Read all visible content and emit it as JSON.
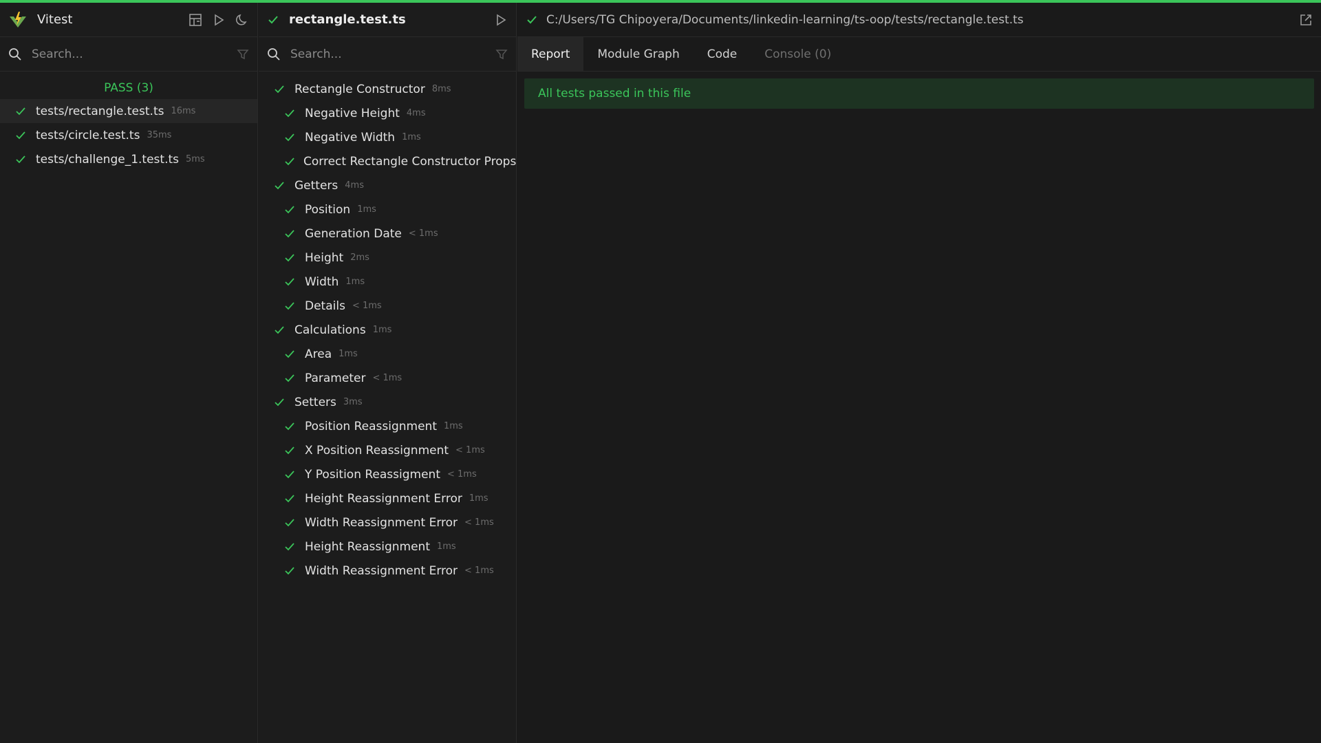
{
  "app": {
    "name": "Vitest"
  },
  "file_explorer": {
    "search_placeholder": "Search...",
    "pass_label": "PASS (3)",
    "files": [
      {
        "name": "tests/rectangle.test.ts",
        "duration": "16ms"
      },
      {
        "name": "tests/circle.test.ts",
        "duration": "35ms"
      },
      {
        "name": "tests/challenge_1.test.ts",
        "duration": "5ms"
      }
    ]
  },
  "test_panel": {
    "file_title": "rectangle.test.ts",
    "search_placeholder": "Search...",
    "tests": [
      {
        "name": "Rectangle Constructor",
        "duration": "8ms",
        "level": 0
      },
      {
        "name": "Negative Height",
        "duration": "4ms",
        "level": 1
      },
      {
        "name": "Negative Width",
        "duration": "1ms",
        "level": 1
      },
      {
        "name": "Correct Rectangle Constructor Props",
        "duration": "",
        "level": 1
      },
      {
        "name": "Getters",
        "duration": "4ms",
        "level": 0
      },
      {
        "name": "Position",
        "duration": "1ms",
        "level": 1
      },
      {
        "name": "Generation Date",
        "duration": "< 1ms",
        "level": 1
      },
      {
        "name": "Height",
        "duration": "2ms",
        "level": 1
      },
      {
        "name": "Width",
        "duration": "1ms",
        "level": 1
      },
      {
        "name": "Details",
        "duration": "< 1ms",
        "level": 1
      },
      {
        "name": "Calculations",
        "duration": "1ms",
        "level": 0
      },
      {
        "name": "Area",
        "duration": "1ms",
        "level": 1
      },
      {
        "name": "Parameter",
        "duration": "< 1ms",
        "level": 1
      },
      {
        "name": "Setters",
        "duration": "3ms",
        "level": 0
      },
      {
        "name": "Position Reassignment",
        "duration": "1ms",
        "level": 1
      },
      {
        "name": "X Position Reassignment",
        "duration": "< 1ms",
        "level": 1
      },
      {
        "name": "Y Position Reassigment",
        "duration": "< 1ms",
        "level": 1
      },
      {
        "name": "Height Reassignment Error",
        "duration": "1ms",
        "level": 1
      },
      {
        "name": "Width Reassignment Error",
        "duration": "< 1ms",
        "level": 1
      },
      {
        "name": "Height Reassignment",
        "duration": "1ms",
        "level": 1
      },
      {
        "name": "Width Reassignment Error",
        "duration": "< 1ms",
        "level": 1
      }
    ]
  },
  "detail": {
    "path": "C:/Users/TG Chipoyera/Documents/linkedin-learning/ts-oop/tests/rectangle.test.ts",
    "tabs": [
      {
        "label": "Report",
        "state": "active"
      },
      {
        "label": "Module Graph",
        "state": "normal"
      },
      {
        "label": "Code",
        "state": "normal"
      },
      {
        "label": "Console (0)",
        "state": "disabled"
      }
    ],
    "banner": "All tests passed in this file"
  },
  "colors": {
    "accent": "#3bc55a",
    "background": "#1a1a1a",
    "banner_bg": "#1d3322"
  },
  "icons": [
    "vitest-logo-icon",
    "dashboard-icon",
    "run-icon",
    "theme-moon-icon",
    "search-icon",
    "filter-icon",
    "check-icon",
    "open-external-icon"
  ]
}
